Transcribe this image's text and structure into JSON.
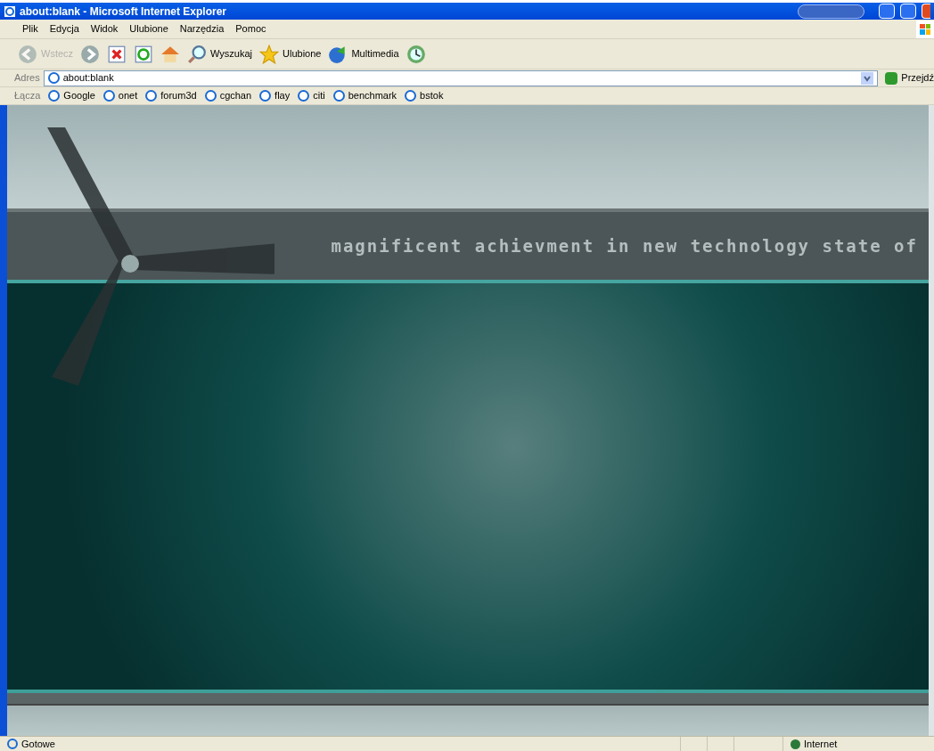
{
  "window": {
    "title": "about:blank - Microsoft Internet Explorer"
  },
  "menu": [
    "Plik",
    "Edycja",
    "Widok",
    "Ulubione",
    "Narzędzia",
    "Pomoc"
  ],
  "toolbar": [
    {
      "kind": "back",
      "label": "Wstecz",
      "disabled": true
    },
    {
      "kind": "forward",
      "disabled": false
    },
    {
      "kind": "stop",
      "disabled": false
    },
    {
      "kind": "refresh",
      "disabled": false
    },
    {
      "kind": "home",
      "disabled": false
    },
    {
      "kind": "search",
      "label": "Wyszukaj",
      "disabled": false
    },
    {
      "kind": "favorites",
      "label": "Ulubione",
      "disabled": false
    },
    {
      "kind": "media",
      "label": "Multimedia",
      "disabled": false
    },
    {
      "kind": "history",
      "disabled": false
    }
  ],
  "address": {
    "label": "Adres",
    "value": "about:blank",
    "go": "Przejdź"
  },
  "links": {
    "label": "Łącza",
    "items": [
      "Google",
      "onet",
      "forum3d",
      "cgchan",
      "flay",
      "citi",
      "benchmark",
      "bstok"
    ]
  },
  "page": {
    "banner_text": "magnificent achievment in new technology state of"
  },
  "status_bar": {
    "text": "Gotowe",
    "zone": "Internet"
  }
}
